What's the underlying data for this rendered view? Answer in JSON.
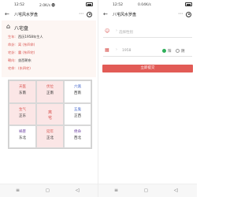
{
  "status": {
    "left_time": "12:52",
    "left_net": "2.0K/s 🅗",
    "right_time": "12:52",
    "right_net": "0.04K/s"
  },
  "appbar": {
    "back": "←",
    "title": "八宅风水罗盘",
    "more": "⋯"
  },
  "info": {
    "heading": "八宅盘",
    "rows": [
      {
        "label": "生年:",
        "value": "西历1958年生人",
        "red": false
      },
      {
        "label": "命卦:",
        "value": "离 (东四命)",
        "red": true
      },
      {
        "label": "宅卦:",
        "value": "震 (东四宅)",
        "red": true
      },
      {
        "label": "朝向:",
        "value": "坐西朝东",
        "red": false
      },
      {
        "label": "宅命:",
        "value": "(东四宅)",
        "red": true
      }
    ]
  },
  "grid": [
    {
      "top": "天医",
      "bottom": "东南",
      "color": "red",
      "pink": true
    },
    {
      "top": "伏位",
      "bottom": "正南",
      "color": "red",
      "pink": true
    },
    {
      "top": "六煞",
      "bottom": "西南",
      "color": "blue",
      "pink": false
    },
    {
      "top": "生气",
      "bottom": "正东",
      "color": "red",
      "pink": true
    },
    {
      "center": "离\n宅",
      "pink": true
    },
    {
      "top": "五鬼",
      "bottom": "正西",
      "color": "blue",
      "pink": false
    },
    {
      "top": "祸害",
      "bottom": "东北",
      "color": "purple",
      "pink": false
    },
    {
      "top": "延年",
      "bottom": "正北",
      "color": "red",
      "pink": true
    },
    {
      "top": "绝命",
      "bottom": "西北",
      "color": "purple",
      "pink": false
    }
  ],
  "form": {
    "gender_placeholder": "选择性别",
    "year_value": "1958",
    "option_a": "阳",
    "option_b": "阴",
    "submit_label": "立即提交"
  },
  "navbar": {
    "menu": "≡",
    "home": "□",
    "back": "◁"
  },
  "colors": {
    "accent": "#e25b56",
    "check_on": "#2fb05a"
  }
}
